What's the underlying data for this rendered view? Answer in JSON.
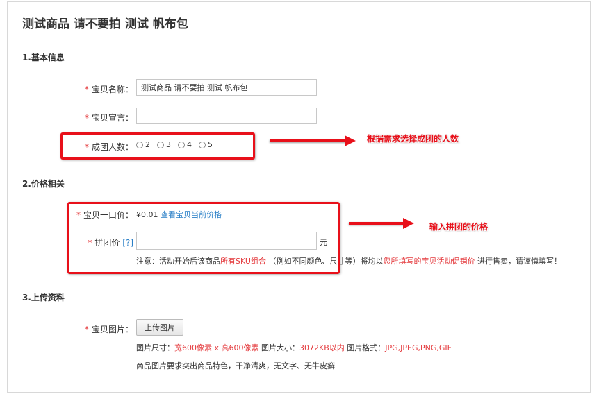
{
  "page_title": "测试商品 请不要拍 测试 帆布包",
  "sections": {
    "basic": "1.基本信息",
    "price": "2.价格相关",
    "upload": "3.上传资料"
  },
  "required_mark": "*",
  "basic": {
    "name_label": "宝贝名称：",
    "name_value": "测试商品 请不要拍 测试 帆布包",
    "slogan_label": "宝贝宣言：",
    "slogan_value": "",
    "group_label": "成团人数：",
    "group_options": [
      "2",
      "3",
      "4",
      "5"
    ]
  },
  "price": {
    "fixed_label": "宝贝一口价：",
    "fixed_value": "¥0.01",
    "fixed_link": "查看宝贝当前价格",
    "group_label": "拼团价",
    "help": "[?]",
    "group_value": "",
    "unit": "元",
    "notice_1": "注意：活动开始后该商品",
    "notice_2": "所有SKU组合",
    "notice_3": " （例如不同颜色、尺寸等）将均以",
    "notice_4": "您所填写的宝贝活动促销价",
    "notice_5": " 进行售卖，请谨慎填写！"
  },
  "upload": {
    "image_label": "宝贝图片：",
    "button": "上传图片",
    "size_label": "图片尺寸：",
    "size_value": "宽600像素 x 高600像素",
    "filesize_label": "图片大小：",
    "filesize_value": "3072KB以内",
    "format_label": "图片格式：",
    "format_value": "JPG,JPEG,PNG,GIF",
    "requirement": "商品图片要求突出商品特色，干净清爽，无文字、无牛皮癣"
  },
  "annotations": {
    "group_size": "根据需求选择成团的人数",
    "group_price": "输入拼团的价格"
  },
  "colors": {
    "annotation": "#e8101a",
    "link": "#2a7fc7",
    "required": "#e4393c"
  }
}
